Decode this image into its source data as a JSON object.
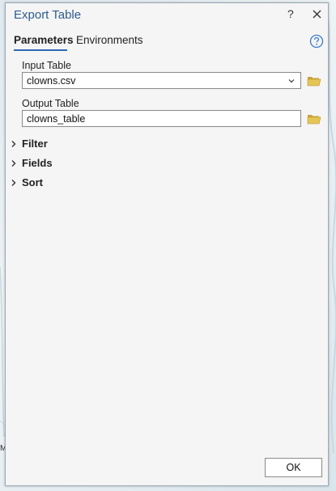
{
  "dialog": {
    "title": "Export Table",
    "help_label": "?",
    "close_icon": "close-icon"
  },
  "tabs": [
    {
      "label": "Parameters",
      "active": true
    },
    {
      "label": "Environments",
      "active": false
    }
  ],
  "parameters": {
    "input_table": {
      "label": "Input Table",
      "value": "clowns.csv"
    },
    "output_table": {
      "label": "Output Table",
      "value": "clowns_table"
    }
  },
  "sections": [
    {
      "label": "Filter"
    },
    {
      "label": "Fields"
    },
    {
      "label": "Sort"
    }
  ],
  "footer": {
    "ok_label": "OK"
  },
  "background": {
    "map_letter": "M"
  },
  "colors": {
    "accent": "#2d6ab1",
    "title": "#2d5c8f",
    "folder": "#d9b84a"
  }
}
